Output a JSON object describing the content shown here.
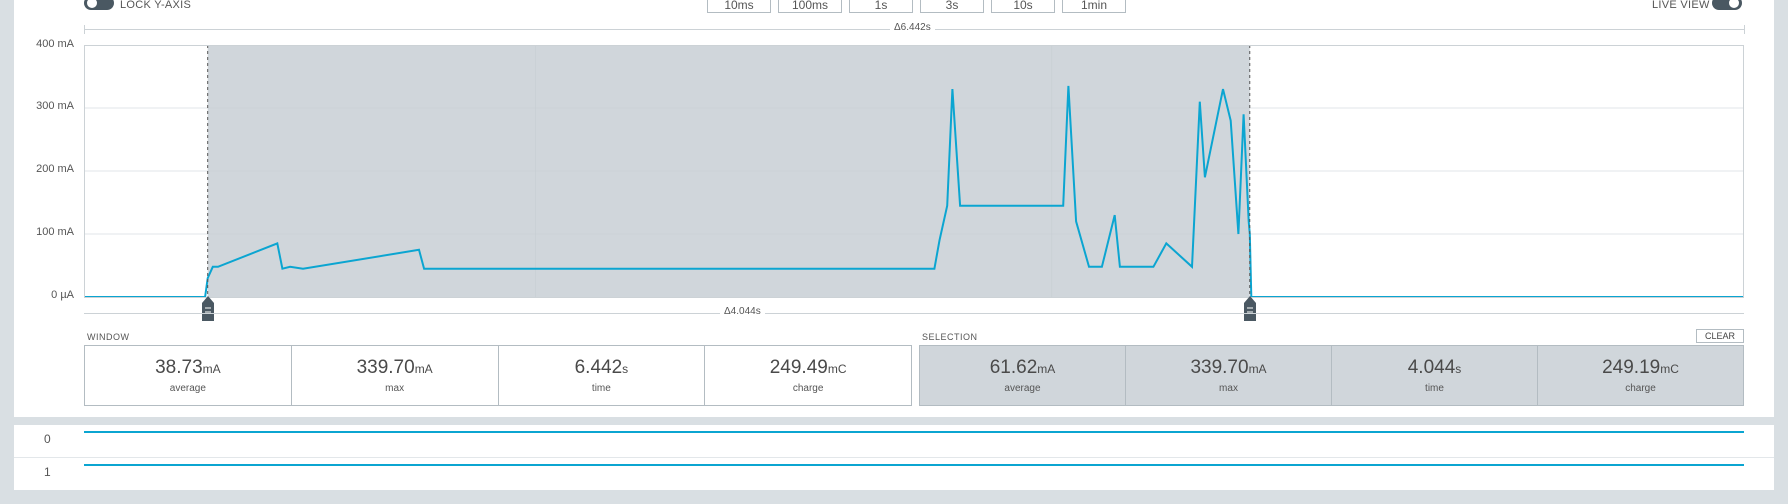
{
  "toolbar": {
    "lock_y_axis_label": "LOCK Y-AXIS",
    "live_view_label": "LIVE VIEW",
    "window_buttons": [
      "10ms",
      "100ms",
      "1s",
      "3s",
      "10s",
      "1min"
    ]
  },
  "chart": {
    "window_delta": "Δ6.442s",
    "selection_delta": "Δ4.044s",
    "y_ticks": [
      "400 mA",
      "300 mA",
      "200 mA",
      "100 mA",
      "0 µA"
    ]
  },
  "chart_data": {
    "type": "line",
    "ylabel": "",
    "xlabel": "",
    "xlim": [
      0,
      6.442
    ],
    "ylim": [
      0,
      400
    ],
    "y_ticks": [
      "0 µA",
      "100 mA",
      "200 mA",
      "300 mA",
      "400 mA"
    ],
    "selection_range": [
      0.48,
      4.524
    ],
    "series": [
      {
        "x": [
          0,
          0.47,
          0.48,
          0.5,
          0.52,
          0.75,
          0.77,
          0.8,
          0.85,
          1.3,
          1.32,
          1.4,
          3.3,
          3.32,
          3.35,
          3.37,
          3.4,
          3.6,
          3.8,
          3.82,
          3.85,
          3.9,
          3.95,
          4.0,
          4.02,
          4.1,
          4.15,
          4.2,
          4.3,
          4.33,
          4.35,
          4.42,
          4.45,
          4.48,
          4.5,
          4.52,
          4.524,
          4.53,
          5.0,
          6.442
        ],
        "y": [
          0,
          0,
          30,
          48,
          48,
          85,
          45,
          48,
          45,
          75,
          45,
          45,
          45,
          90,
          145,
          330,
          145,
          145,
          145,
          335,
          120,
          48,
          48,
          130,
          48,
          48,
          48,
          85,
          48,
          310,
          190,
          330,
          280,
          100,
          290,
          120,
          100,
          0,
          0,
          0
        ]
      }
    ]
  },
  "window_stats": {
    "label": "WINDOW",
    "average": {
      "value": "38.73",
      "unit": "mA",
      "caption": "average"
    },
    "max": {
      "value": "339.70",
      "unit": "mA",
      "caption": "max"
    },
    "time": {
      "value": "6.442",
      "unit": "s",
      "caption": "time"
    },
    "charge": {
      "value": "249.49",
      "unit": "mC",
      "caption": "charge"
    }
  },
  "selection_stats": {
    "label": "SELECTION",
    "clear_label": "CLEAR",
    "average": {
      "value": "61.62",
      "unit": "mA",
      "caption": "average"
    },
    "max": {
      "value": "339.70",
      "unit": "mA",
      "caption": "max"
    },
    "time": {
      "value": "4.044",
      "unit": "s",
      "caption": "time"
    },
    "charge": {
      "value": "249.19",
      "unit": "mC",
      "caption": "charge"
    }
  },
  "digital_channels": [
    {
      "label": "0"
    },
    {
      "label": "1"
    }
  ],
  "colors": {
    "trace": "#0ba5d1",
    "selection_fill": "#d0d6db",
    "background": "#d9dfe3"
  }
}
